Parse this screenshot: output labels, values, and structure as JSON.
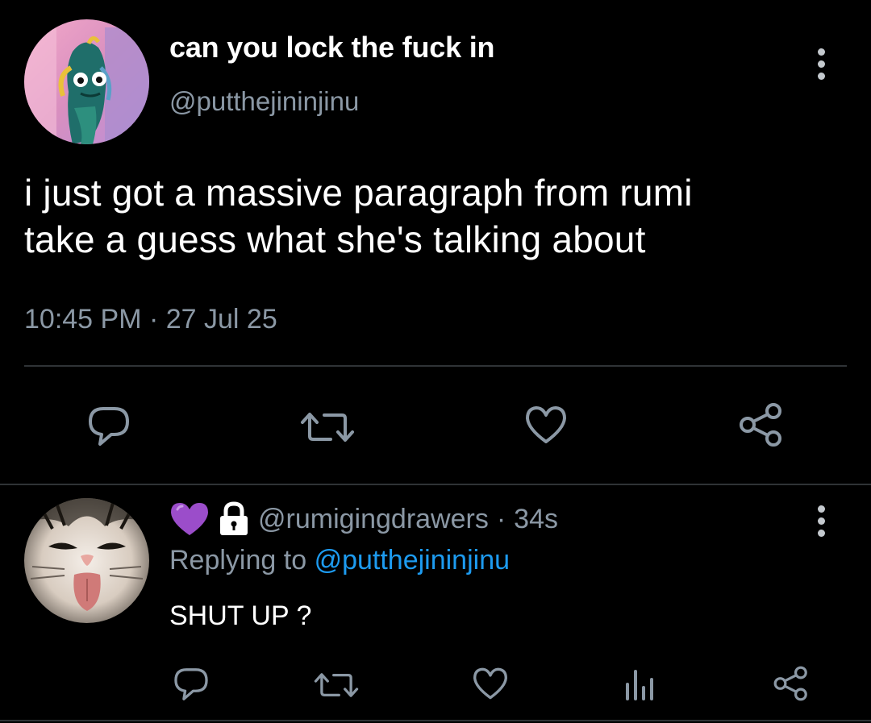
{
  "main_tweet": {
    "display_name": "can you lock the fuck in",
    "handle": "@putthejininjinu",
    "text_lines": [
      "i just got a massive paragraph from rumi",
      "take a guess what she's talking about"
    ],
    "timestamp": "10:45 PM · 27 Jul 25",
    "avatar_icon": "fish-character-avatar",
    "actions": [
      "reply-icon",
      "retweet-icon",
      "like-icon",
      "share-icon"
    ]
  },
  "reply": {
    "badges": [
      "purple-heart-icon",
      "lock-icon"
    ],
    "handle": "@rumigingdrawers",
    "separator": "·",
    "time": "34s",
    "replying_prefix": "Replying to",
    "replying_to": "@putthejininjinu",
    "text": "SHUT UP ?",
    "avatar_icon": "cat-tongue-avatar",
    "actions": [
      "reply-icon",
      "retweet-icon",
      "like-icon",
      "analytics-icon",
      "share-icon"
    ]
  },
  "colors": {
    "background": "#000000",
    "text_primary": "#ffffff",
    "text_secondary": "#8b98a5",
    "link": "#1d9bf0",
    "divider": "#2f3336",
    "icon": "#8b98a5",
    "purple_heart": "#9b4dca"
  }
}
